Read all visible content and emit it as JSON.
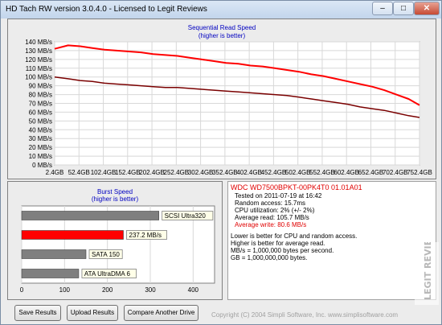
{
  "window": {
    "title": "HD Tach RW version 3.0.4.0 - Licensed to Legit Reviews",
    "minimize_glyph": "–",
    "maximize_glyph": "□",
    "close_glyph": "✕"
  },
  "read_chart": {
    "title": "Sequential Read Speed",
    "subtitle": "(higher is better)"
  },
  "burst_chart": {
    "title": "Burst Speed",
    "subtitle": "(higher is better)"
  },
  "drive_info": {
    "name": "WDC WD7500BPKT-00PK4T0 01.01A01",
    "tested_on": "Tested on 2011-07-19 at 16:42",
    "random_access": "Random access: 15.7ms",
    "cpu_utilization": "CPU utilization: 2% (+/- 2%)",
    "average_read": "Average read: 105.7 MB/s",
    "average_write": "Average write: 80.6 MB/s",
    "note_1": "Lower is better for CPU and random access.",
    "note_2": "Higher is better for average read.",
    "note_3": "MB/s = 1,000,000 bytes per second.",
    "note_4": "GB = 1,000,000,000 bytes."
  },
  "buttons": {
    "save": "Save Results",
    "upload": "Upload Results",
    "compare": "Compare Another Drive"
  },
  "copyright": "Copyright (C) 2004 Simpli Software, Inc. www.simplisoftware.com",
  "watermark": "LEGIT REVIEWS",
  "colors": {
    "read_line": "#ff0000",
    "write_line": "#7a0000",
    "bar_gray": "#7f7f7f",
    "bar_red": "#ff0000",
    "title_blue": "#0000c0"
  },
  "chart_data": [
    {
      "type": "line",
      "title": "Sequential Read Speed",
      "subtitle": "(higher is better)",
      "x_ticks": [
        "2.4GB",
        "52.4GB",
        "102.4GB",
        "152.4GB",
        "202.4GB",
        "252.4GB",
        "302.4GB",
        "352.4GB",
        "402.4GB",
        "452.4GB",
        "502.4GB",
        "552.4GB",
        "602.4GB",
        "652.4GB",
        "702.4GB",
        "752.4GB"
      ],
      "y_ticks": [
        "0 MB/s",
        "10 MB/s",
        "20 MB/s",
        "30 MB/s",
        "40 MB/s",
        "50 MB/s",
        "60 MB/s",
        "70 MB/s",
        "80 MB/s",
        "90 MB/s",
        "100 MB/s",
        "110 MB/s",
        "120 MB/s",
        "130 MB/s",
        "140 MB/s"
      ],
      "xlim": [
        2.4,
        752.4
      ],
      "ylim": [
        0,
        140
      ],
      "grid": true,
      "series": [
        {
          "x": [
            2.4,
            30,
            55,
            80,
            105,
            130,
            155,
            180,
            205,
            230,
            255,
            280,
            305,
            330,
            355,
            380,
            405,
            430,
            455,
            480,
            505,
            530,
            555,
            580,
            605,
            630,
            655,
            680,
            705,
            730,
            760
          ],
          "values": [
            132,
            136,
            135,
            133,
            131,
            130,
            129,
            128,
            126,
            125,
            124,
            122,
            120,
            118,
            116,
            115,
            113,
            112,
            110,
            108,
            106,
            103,
            101,
            98,
            95,
            92,
            89,
            85,
            80,
            75,
            68
          ]
        },
        {
          "x": [
            2.4,
            30,
            55,
            80,
            105,
            130,
            155,
            180,
            205,
            230,
            255,
            280,
            305,
            330,
            355,
            380,
            405,
            430,
            455,
            480,
            505,
            530,
            555,
            580,
            605,
            630,
            655,
            680,
            705,
            730,
            760
          ],
          "values": [
            100,
            98,
            96,
            95,
            93,
            92,
            91,
            90,
            89,
            88,
            88,
            87,
            86,
            85,
            84,
            83,
            82,
            81,
            80,
            79,
            77,
            75,
            73,
            71,
            69,
            66,
            64,
            62,
            59,
            56,
            54
          ]
        }
      ]
    },
    {
      "type": "bar",
      "title": "Burst Speed",
      "subtitle": "(higher is better)",
      "categories": [
        "SCSI Ultra320",
        "237.2 MB/s",
        "SATA 150",
        "ATA UltraDMA 6"
      ],
      "values": [
        320,
        237.2,
        150,
        133
      ],
      "x_ticks": [
        "0",
        "100",
        "200",
        "300",
        "400"
      ],
      "xlim": [
        0,
        450
      ]
    }
  ]
}
